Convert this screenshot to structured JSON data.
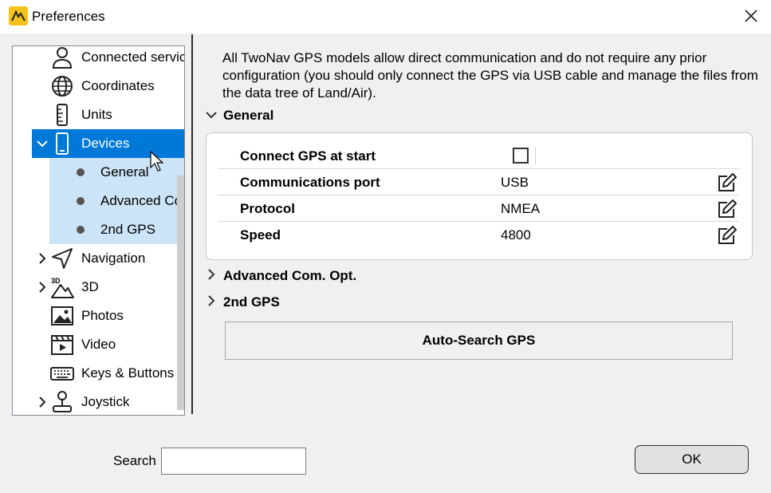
{
  "window": {
    "title": "Preferences",
    "icons": {
      "app": "twonav-app-icon",
      "close": "close-icon"
    }
  },
  "tree": {
    "items": [
      {
        "label": "Connected servic",
        "icon": "person-icon",
        "expandable": false
      },
      {
        "label": "Coordinates",
        "icon": "globe-icon",
        "expandable": false
      },
      {
        "label": "Units",
        "icon": "ruler-icon",
        "expandable": false
      },
      {
        "label": "Devices",
        "icon": "phone-icon",
        "expandable": true,
        "expanded": true,
        "selected": true
      },
      {
        "label": "General",
        "child": true
      },
      {
        "label": "Advanced Co",
        "child": true
      },
      {
        "label": "2nd GPS",
        "child": true
      },
      {
        "label": "Navigation",
        "icon": "navigation-arrow-icon",
        "expandable": true
      },
      {
        "label": "3D",
        "icon": "3d-mountain-icon",
        "expandable": true
      },
      {
        "label": "Photos",
        "icon": "photo-icon",
        "expandable": false
      },
      {
        "label": "Video",
        "icon": "video-icon",
        "expandable": false
      },
      {
        "label": "Keys & Buttons",
        "icon": "keyboard-icon",
        "expandable": false
      },
      {
        "label": "Joystick",
        "icon": "joystick-icon",
        "expandable": true
      }
    ]
  },
  "main": {
    "description": "All TwoNav GPS models allow direct communication and do not require any prior configuration (you should only connect the GPS via USB cable and manage the files from the data tree of Land/Air).",
    "sections": {
      "general": {
        "title": "General",
        "expanded": true
      },
      "advanced": {
        "title": "Advanced Com. Opt.",
        "expanded": false
      },
      "second_gps": {
        "title": "2nd GPS",
        "expanded": false
      }
    },
    "properties": [
      {
        "name": "Connect GPS at start",
        "type": "checkbox",
        "checked": false
      },
      {
        "name": "Communications port",
        "value": "USB"
      },
      {
        "name": "Protocol",
        "value": "NMEA"
      },
      {
        "name": "Speed",
        "value": "4800"
      }
    ],
    "auto_search_label": "Auto-Search GPS"
  },
  "footer": {
    "search_label": "Search",
    "search_value": "",
    "ok_label": "OK"
  },
  "colors": {
    "selection": "#0078d7",
    "child_highlight": "#cce4f7",
    "app_icon": "#f5c21b"
  }
}
